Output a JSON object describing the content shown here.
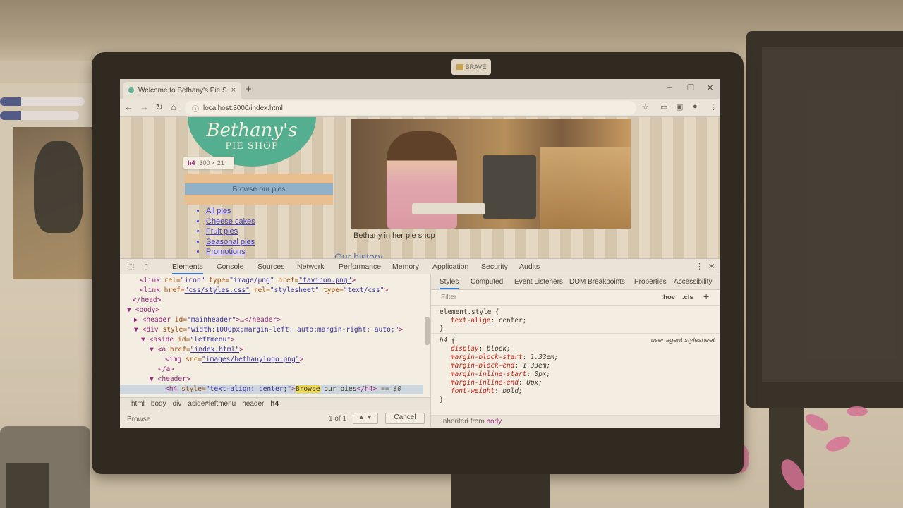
{
  "monitor": {
    "badge": "BRAVE"
  },
  "browser": {
    "tab_title": "Welcome to Bethany's Pie Shop!",
    "tab_close": "×",
    "new_tab": "+",
    "window_controls": [
      "–",
      "❐",
      "✕"
    ],
    "url": "localhost:3000/index.html",
    "nav_icons": [
      "back-icon",
      "forward-icon",
      "reload-icon",
      "home-icon"
    ]
  },
  "page": {
    "logo_line1": "Bethany's",
    "logo_line2": "PIE SHOP",
    "tooltip_tag": "h4",
    "tooltip_dims": "300 × 21",
    "browse_heading": "Browse our pies",
    "pie_links": [
      "All pies",
      "Cheese cakes",
      "Fruit pies",
      "Seasonal pies",
      "Promotions"
    ],
    "hero_caption": "Bethany in her pie shop",
    "history_heading": "Our history"
  },
  "devtools": {
    "tabs": [
      "Elements",
      "Console",
      "Sources",
      "Network",
      "Performance",
      "Memory",
      "Application",
      "Security",
      "Audits"
    ],
    "active_tab": "Elements",
    "elements_lines": {
      "l1": {
        "tag_open": "<link ",
        "a1": "rel=",
        "v1": "\"icon\"",
        "a2": " type=",
        "v2": "\"image/png\"",
        "a3": " href=",
        "v3": "\"favicon.png\"",
        "tag_close": ">"
      },
      "l2": {
        "tag_open": "<link ",
        "a1": "href=",
        "v1": "\"css/styles.css\"",
        "a2": " rel=",
        "v2": "\"stylesheet\"",
        "a3": " type=",
        "v3": "\"text/css\"",
        "tag_close": ">"
      },
      "l3": "</head>",
      "l4": "▼ <body>",
      "l5": {
        "pre": "▶ <header ",
        "a": "id=",
        "v": "\"mainheader\"",
        "post": ">…</header>"
      },
      "l6": {
        "pre": "▼ <div ",
        "a": "style=",
        "v": "\"width:1000px;margin-left: auto;margin-right: auto;\"",
        "post": ">"
      },
      "l7": {
        "pre": "▼ <aside ",
        "a": "id=",
        "v": "\"leftmenu\"",
        "post": ">"
      },
      "l8": {
        "pre": "▼ <a ",
        "a": "href=",
        "v": "\"index.html\"",
        "post": ">"
      },
      "l9": {
        "pre": "<img ",
        "a": "src=",
        "v": "\"images/bethanylogo.png\"",
        "post": ">"
      },
      "l10": "</a>",
      "l11": "▼ <header>",
      "l12": {
        "pre": "<h4 ",
        "a": "style=",
        "v": "\"text-align: center;\"",
        "post": ">",
        "hl": "Browse",
        "txt": " our pies",
        "end": "</h4>",
        "eq": " == $0"
      }
    },
    "breadcrumbs": [
      "html",
      "body",
      "div",
      "aside#leftmenu",
      "header",
      "h4"
    ],
    "search_query": "Browse",
    "search_count": "1 of 1",
    "search_arrows": "▲ ▼",
    "cancel": "Cancel",
    "styles_tabs": [
      "Styles",
      "Computed",
      "Event Listeners",
      "DOM Breakpoints",
      "Properties",
      "Accessibility"
    ],
    "filter_placeholder": "Filter",
    "hov": ":hov",
    "cls": ".cls",
    "add": "+",
    "element_style": {
      "selector": "element.style {",
      "props": [
        {
          "k": "text-align",
          "v": "center;"
        }
      ],
      "close": "}"
    },
    "h4_rule": {
      "selector": "h4 {",
      "source": "user agent stylesheet",
      "props": [
        {
          "k": "display",
          "v": "block;"
        },
        {
          "k": "margin-block-start",
          "v": "1.33em;"
        },
        {
          "k": "margin-block-end",
          "v": "1.33em;"
        },
        {
          "k": "margin-inline-start",
          "v": "0px;"
        },
        {
          "k": "margin-inline-end",
          "v": "0px;"
        },
        {
          "k": "font-weight",
          "v": "bold;"
        }
      ],
      "close": "}"
    },
    "inherited_label": "Inherited from",
    "inherited_tag": "body"
  }
}
